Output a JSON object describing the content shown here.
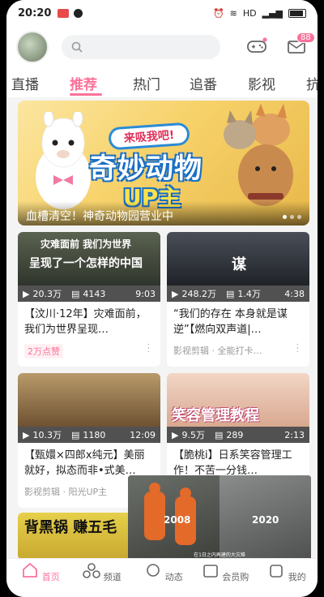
{
  "status": {
    "time": "20:20",
    "net": "HD"
  },
  "header": {
    "message_badge": "88"
  },
  "tabs": [
    {
      "label": "直播"
    },
    {
      "label": "推荐",
      "active": true
    },
    {
      "label": "热门"
    },
    {
      "label": "追番"
    },
    {
      "label": "影视"
    },
    {
      "label": "抗"
    }
  ],
  "banner": {
    "bubble": "来吸我吧!",
    "headline": "奇妙动物",
    "sub": "UP主",
    "caption": "血槽清空！神奇动物园营业中"
  },
  "cards": [
    {
      "thumb_top": "灾难面前  我们为世界",
      "thumb_bottom": "呈现了一个怎样的中国",
      "views": "20.3万",
      "comments": "4143",
      "duration": "9:03",
      "title": "【汶川·12年】灾难面前，我们为世界呈现…",
      "tag": "2万点赞"
    },
    {
      "thumb_overlay": "谋",
      "views": "248.2万",
      "comments": "1.4万",
      "duration": "4:38",
      "title": "“我们的存在 本身就是谋逆”【燃向双声道|…",
      "meta": "影视剪辑 · 全能打卡…"
    },
    {
      "views": "10.3万",
      "comments": "1180",
      "duration": "12:09",
      "title": "【甄嬛×四郎x纯元】美丽就好，拟态而非•式美…",
      "meta": "影视剪辑 · 阳光UP主"
    },
    {
      "thumb_overlay": "笑容管理教程",
      "views": "9.5万",
      "comments": "289",
      "duration": "2:13",
      "title": "【脆桃i】日系笑容管理工作！不苦一分钱…",
      "meta": ""
    },
    {
      "thumb_overlay": "背黑锅 赚五毛"
    }
  ],
  "mini_player": {
    "year_left": "2008",
    "year_right": "2020",
    "caption": "在1日之内再建的大灾难"
  },
  "bottomnav": [
    {
      "label": "首页",
      "active": true
    },
    {
      "label": "频道"
    },
    {
      "label": "动态"
    },
    {
      "label": "会员购"
    },
    {
      "label": "我的"
    }
  ],
  "colors": {
    "accent": "#fb7299"
  }
}
